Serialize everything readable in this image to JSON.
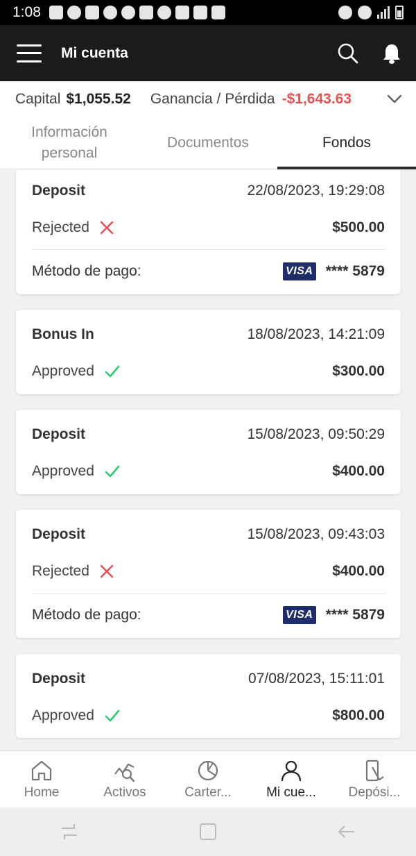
{
  "status_bar": {
    "time": "1:08"
  },
  "app_bar": {
    "title": "Mi cuenta"
  },
  "summary": {
    "capital_label": "Capital",
    "capital_value": "$1,055.52",
    "gp_label": "Ganancia / Pérdida",
    "gp_value": "-$1,643.63"
  },
  "tabs": [
    {
      "label": "Información\npersonal"
    },
    {
      "label": "Documentos"
    },
    {
      "label": "Fondos"
    }
  ],
  "payment_label": "Método de pago:",
  "visa_label": "VISA",
  "transactions": [
    {
      "type": "Deposit",
      "datetime": "22/08/2023, 19:29:08",
      "status": "Rejected",
      "amount": "$500.00",
      "card": "**** 5879"
    },
    {
      "type": "Bonus In",
      "datetime": "18/08/2023, 14:21:09",
      "status": "Approved",
      "amount": "$300.00"
    },
    {
      "type": "Deposit",
      "datetime": "15/08/2023, 09:50:29",
      "status": "Approved",
      "amount": "$400.00"
    },
    {
      "type": "Deposit",
      "datetime": "15/08/2023, 09:43:03",
      "status": "Rejected",
      "amount": "$400.00",
      "card": "**** 5879"
    },
    {
      "type": "Deposit",
      "datetime": "07/08/2023, 15:11:01",
      "status": "Approved",
      "amount": "$800.00"
    }
  ],
  "bottom_nav": [
    {
      "label": "Home",
      "icon": "home-icon"
    },
    {
      "label": "Activos",
      "icon": "assets-chart-icon"
    },
    {
      "label": "Carter...",
      "icon": "portfolio-pie-icon"
    },
    {
      "label": "Mi cue...",
      "icon": "user-icon"
    },
    {
      "label": "Depósi...",
      "icon": "deposit-icon"
    }
  ],
  "colors": {
    "loss": "#e25353",
    "approved": "#2ecc71",
    "rejected": "#e25353",
    "visa": "#1f2d6b"
  }
}
